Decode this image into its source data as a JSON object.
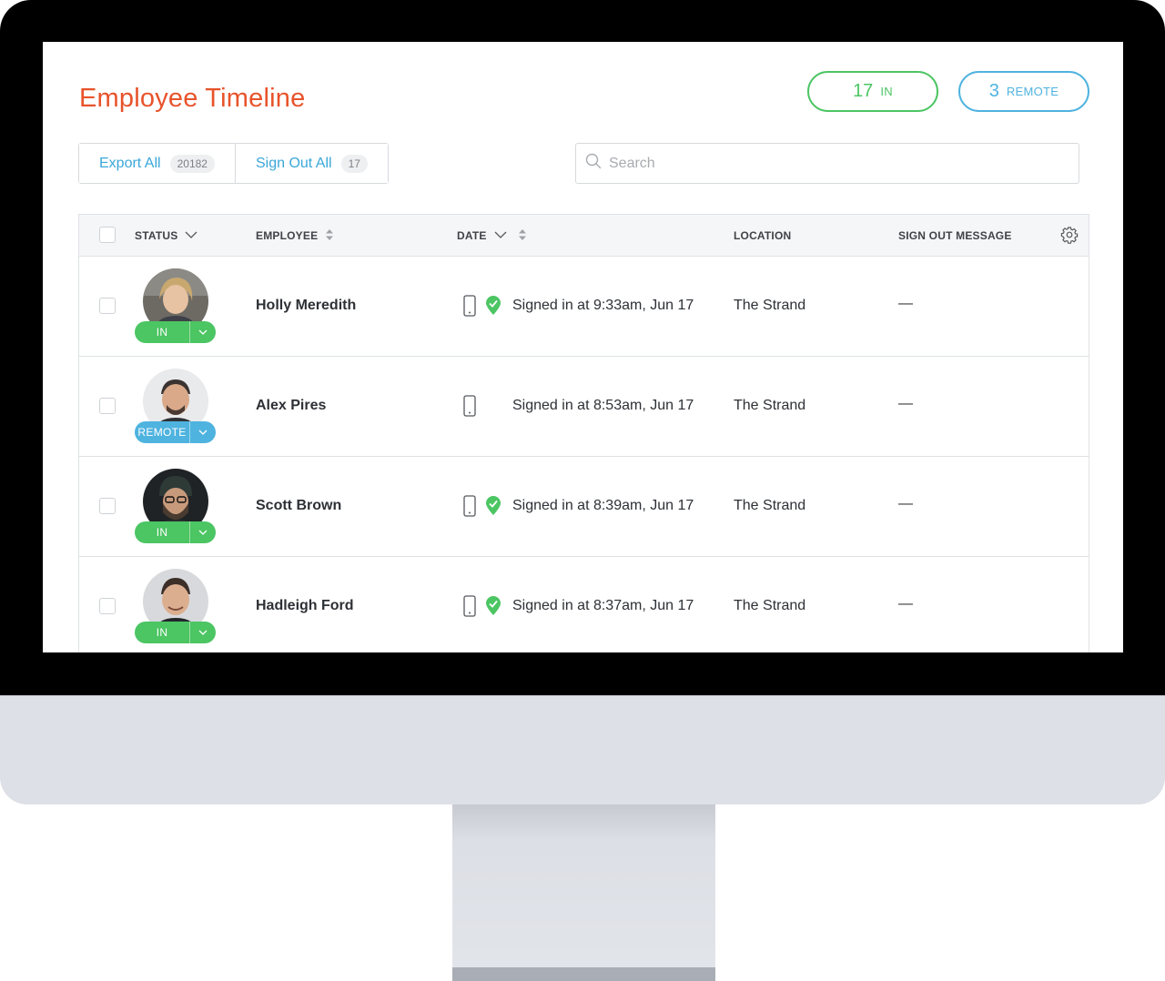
{
  "page": {
    "title": "Employee Timeline"
  },
  "summary": {
    "in": {
      "count": "17",
      "label": "IN"
    },
    "remote": {
      "count": "3",
      "label": "REMOTE"
    }
  },
  "actions": {
    "export": {
      "label": "Export All",
      "count": "20182"
    },
    "signout": {
      "label": "Sign Out All",
      "count": "17"
    }
  },
  "search": {
    "placeholder": "Search",
    "value": ""
  },
  "table": {
    "columns": {
      "status": "STATUS",
      "employee": "EMPLOYEE",
      "date": "DATE",
      "location": "LOCATION",
      "message": "SIGN OUT MESSAGE"
    },
    "rows": [
      {
        "name": "Holly Meredith",
        "status": "IN",
        "date": "Signed in at 9:33am, Jun 17",
        "location": "The Strand",
        "message": "—",
        "verified": true
      },
      {
        "name": "Alex Pires",
        "status": "REMOTE",
        "date": "Signed in at 8:53am, Jun 17",
        "location": "The Strand",
        "message": "—",
        "verified": false
      },
      {
        "name": "Scott Brown",
        "status": "IN",
        "date": "Signed in at 8:39am, Jun 17",
        "location": "The Strand",
        "message": "—",
        "verified": true
      },
      {
        "name": "Hadleigh Ford",
        "status": "IN",
        "date": "Signed in at 8:37am, Jun 17",
        "location": "The Strand",
        "message": "—",
        "verified": true
      }
    ]
  },
  "colors": {
    "title": "#e8532b",
    "in": "#4cc563",
    "remote": "#4fb3df",
    "link": "#3aa7d9"
  },
  "icons": [
    "search-icon",
    "chevron-down-icon",
    "sort-icon",
    "gear-icon",
    "phone-icon",
    "location-verified-icon"
  ]
}
